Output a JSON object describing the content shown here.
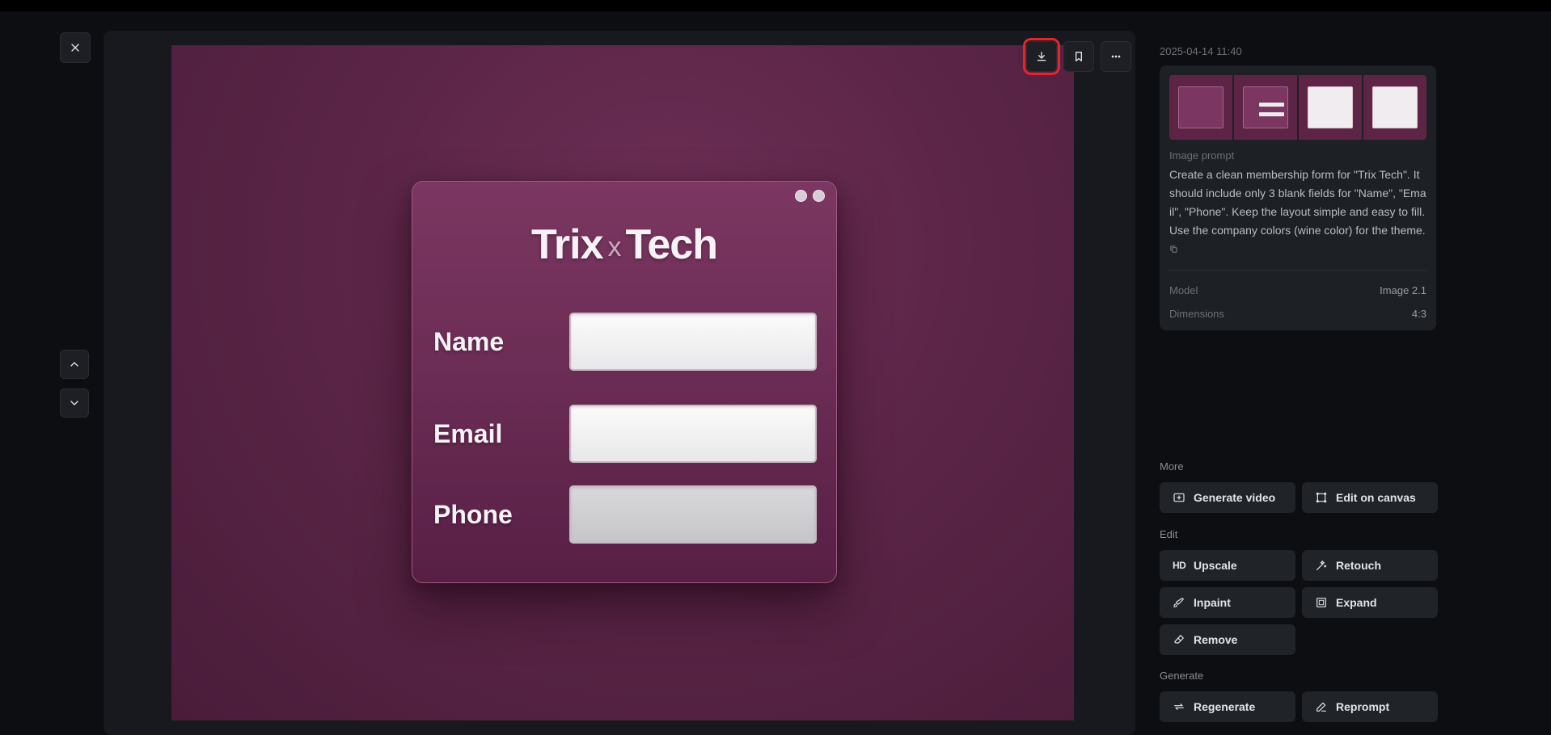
{
  "toolbar": {
    "close_icon": "close-icon",
    "download_icon": "download-icon",
    "bookmark_icon": "bookmark-icon",
    "more_icon": "more-icon"
  },
  "nav": {
    "up_icon": "chevron-up-icon",
    "down_icon": "chevron-down-icon"
  },
  "preview": {
    "brand_left": "Trix",
    "brand_sep": "x",
    "brand_right": "Tech",
    "fields": [
      {
        "label": "Name"
      },
      {
        "label": "Email"
      },
      {
        "label": "Phone"
      }
    ]
  },
  "sidebar": {
    "timestamp": "2025-04-14 11:40",
    "prompt_label": "Image prompt",
    "prompt_text": "Create a clean membership form for \"Trix Tech\". It should include only 3 blank fields for \"Name\", \"Email\", \"Phone\". Keep the layout simple and easy to fill. Use the company colors (wine color) for the theme.",
    "copy_icon": "copy-icon",
    "model_label": "Model",
    "model_value": "Image 2.1",
    "dimensions_label": "Dimensions",
    "dimensions_value": "4:3"
  },
  "groups": {
    "more": "More",
    "edit": "Edit",
    "generate": "Generate"
  },
  "actions": {
    "generate_video": "Generate video",
    "edit_on_canvas": "Edit on canvas",
    "upscale": "Upscale",
    "upscale_badge": "HD",
    "retouch": "Retouch",
    "inpaint": "Inpaint",
    "expand": "Expand",
    "remove": "Remove",
    "regenerate": "Regenerate",
    "reprompt": "Reprompt"
  },
  "colors": {
    "highlight": "#e5252a",
    "wine": "#5b2547"
  }
}
